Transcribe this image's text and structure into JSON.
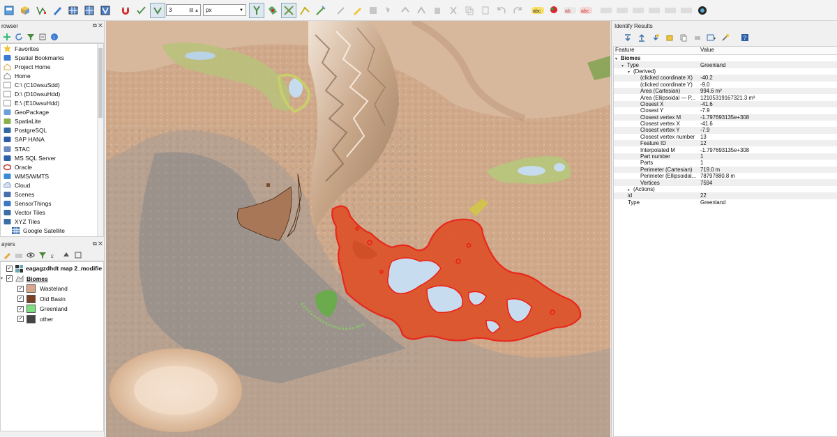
{
  "toolbar": {
    "snap_tolerance": "3",
    "snap_unit": "px",
    "icons": [
      "new-project-icon",
      "open-data-source-icon",
      "vertex-tool-icon",
      "digitize-icon",
      "grid-icon",
      "layout-manager-icon",
      "atlas-icon",
      "magnet-snapping-icon",
      "snapping-mode-icon",
      "vertex-snapping-icon",
      "snapping-settings-icon",
      "topology-icon",
      "intersection-icon",
      "trace-icon",
      "pencil-icon",
      "save-edits-icon",
      "cut-icon",
      "copy-icon",
      "paste-icon",
      "undo-icon",
      "redo-icon",
      "label-abc-icon",
      "label-pin-icon",
      "label-show-icon",
      "label-hide-icon",
      "diagram-icon",
      "plugin-icon"
    ]
  },
  "browser": {
    "title": "rowser",
    "items": [
      {
        "label": "Favorites",
        "icon": "star-icon"
      },
      {
        "label": "Spatial Bookmarks",
        "icon": "bookmark-icon"
      },
      {
        "label": "Project Home",
        "icon": "project-home-icon"
      },
      {
        "label": "Home",
        "icon": "home-icon"
      },
      {
        "label": "C:\\ (C10wsuSdd)",
        "icon": "drive-icon"
      },
      {
        "label": "D:\\ (D10wsuHdd)",
        "icon": "drive-icon"
      },
      {
        "label": "E:\\ (E10wsuHdd)",
        "icon": "drive-icon"
      },
      {
        "label": "GeoPackage",
        "icon": "geopackage-icon"
      },
      {
        "label": "SpatiaLite",
        "icon": "spatialite-icon"
      },
      {
        "label": "PostgreSQL",
        "icon": "postgresql-icon"
      },
      {
        "label": "SAP HANA",
        "icon": "sap-hana-icon"
      },
      {
        "label": "STAC",
        "icon": "stac-icon"
      },
      {
        "label": "MS SQL Server",
        "icon": "mssql-icon"
      },
      {
        "label": "Oracle",
        "icon": "oracle-icon"
      },
      {
        "label": "WMS/WMTS",
        "icon": "wms-icon"
      },
      {
        "label": "Cloud",
        "icon": "cloud-icon"
      },
      {
        "label": "Scenes",
        "icon": "scenes-icon"
      },
      {
        "label": "SensorThings",
        "icon": "sensorthings-icon"
      },
      {
        "label": "Vector Tiles",
        "icon": "vector-tiles-icon"
      },
      {
        "label": "XYZ Tiles",
        "icon": "xyz-tiles-icon"
      },
      {
        "label": "Google Satellite",
        "icon": "grid-layer-icon"
      }
    ]
  },
  "layers": {
    "title": "ayers",
    "map_layer": "eagagzdhdt map 2_modifie",
    "group_layer": "Biomes",
    "legend": [
      {
        "label": "Wasteland",
        "color": "#d9a68c"
      },
      {
        "label": "Old Basin",
        "color": "#7a3f25"
      },
      {
        "label": "Greenland",
        "color": "#7be07b"
      },
      {
        "label": "other",
        "color": "#444444"
      }
    ]
  },
  "identify": {
    "title": "Identify Results",
    "col_feature": "Feature",
    "col_value": "Value",
    "rows": [
      {
        "feature": "Biomes",
        "value": "",
        "indent": 0,
        "bold": true,
        "arrow": "▾"
      },
      {
        "feature": "Type",
        "value": "Greenland",
        "indent": 1,
        "arrow": "▾"
      },
      {
        "feature": "(Derived)",
        "value": "",
        "indent": 2,
        "arrow": "▾"
      },
      {
        "feature": "(clicked coordinate X)",
        "value": "-40.2",
        "indent": 3
      },
      {
        "feature": "(clicked coordinate Y)",
        "value": "-9.0",
        "indent": 3
      },
      {
        "feature": "Area (Cartesian)",
        "value": "994.6 m²",
        "indent": 3
      },
      {
        "feature": "Area (Ellipsoidal — P...",
        "value": "12105319167321.3 m²",
        "indent": 3
      },
      {
        "feature": "Closest X",
        "value": "-41.6",
        "indent": 3
      },
      {
        "feature": "Closest Y",
        "value": "-7.9",
        "indent": 3
      },
      {
        "feature": "Closest vertex M",
        "value": "-1.797693135e+308",
        "indent": 3
      },
      {
        "feature": "Closest vertex X",
        "value": "-41.6",
        "indent": 3
      },
      {
        "feature": "Closest vertex Y",
        "value": "-7.9",
        "indent": 3
      },
      {
        "feature": "Closest vertex number",
        "value": "13",
        "indent": 3
      },
      {
        "feature": "Feature ID",
        "value": "12",
        "indent": 3
      },
      {
        "feature": "Interpolated M",
        "value": "-1.797693135e+308",
        "indent": 3
      },
      {
        "feature": "Part number",
        "value": "1",
        "indent": 3
      },
      {
        "feature": "Parts",
        "value": "1",
        "indent": 3
      },
      {
        "feature": "Perimeter (Cartesian)",
        "value": "719.0 m",
        "indent": 3
      },
      {
        "feature": "Perimeter (Ellipsoidal...",
        "value": "78797880.8 m",
        "indent": 3
      },
      {
        "feature": "Vertices",
        "value": "7594",
        "indent": 3
      },
      {
        "feature": "(Actions)",
        "value": "",
        "indent": 2,
        "arrow": "▸"
      },
      {
        "feature": "id",
        "value": "22",
        "indent": 2
      },
      {
        "feature": "Type",
        "value": "Greenland",
        "indent": 2
      }
    ]
  },
  "colors": {
    "selection": "#e8201a",
    "selection_fill": "#e0552b",
    "terrain": "#d2ad8e",
    "basin": "#a29a93",
    "water": "#c8dcf0",
    "green": "#7ac25a"
  }
}
